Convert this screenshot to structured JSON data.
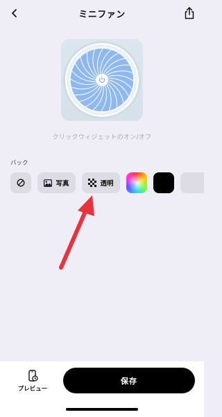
{
  "header": {
    "title": "ミニファン",
    "back_icon": "chevron-left-icon",
    "share_icon": "share-icon"
  },
  "preview": {
    "caption": "クリックウィジェットのオン/オフ",
    "fan_color": "#8fb8ee"
  },
  "background_section": {
    "label": "バック",
    "options": [
      {
        "name": "none",
        "icon": "no-symbol-icon",
        "label": ""
      },
      {
        "name": "photo",
        "icon": "image-icon",
        "label": "写真"
      },
      {
        "name": "transparent",
        "icon": "checkerboard-icon",
        "label": "透明"
      },
      {
        "name": "color-picker",
        "icon": "color-wheel-icon",
        "label": ""
      },
      {
        "name": "black",
        "color": "#000000",
        "label": ""
      },
      {
        "name": "light-gray",
        "color": "#dddbe4",
        "label": ""
      }
    ]
  },
  "annotation": {
    "arrow_color": "#e8333d"
  },
  "bottom": {
    "preview_label": "プレビュー",
    "save_label": "保存"
  }
}
